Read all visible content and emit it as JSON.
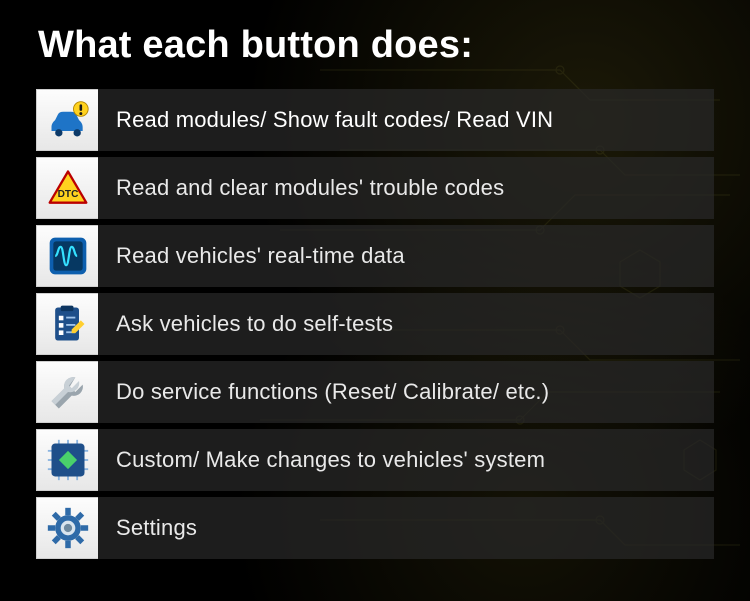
{
  "title": "What each button does:",
  "buttons": [
    {
      "icon": "car-info-icon",
      "label": "Read modules/ Show fault codes/ Read VIN"
    },
    {
      "icon": "dtc-warning-icon",
      "label": "Read and clear modules' trouble codes"
    },
    {
      "icon": "waveform-icon",
      "label": "Read vehicles' real-time data"
    },
    {
      "icon": "checklist-icon",
      "label": "Ask vehicles to do self-tests"
    },
    {
      "icon": "wrench-icon",
      "label": "Do service functions (Reset/ Calibrate/ etc.)"
    },
    {
      "icon": "chip-icon",
      "label": "Custom/ Make changes to vehicles' system"
    },
    {
      "icon": "gear-icon",
      "label": "Settings"
    }
  ]
}
